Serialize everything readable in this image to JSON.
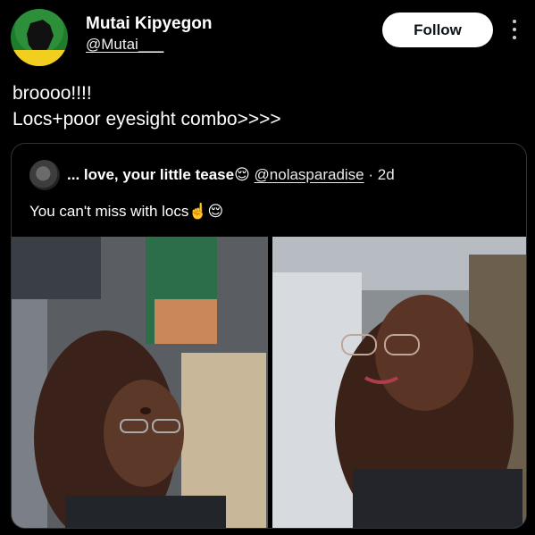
{
  "author": {
    "name": "Mutai Kipyegon",
    "handle": "@Mutai___",
    "avatar_icon": "kenya-map-icon"
  },
  "follow_label": "Follow",
  "more_icon": "more-vertical-icon",
  "post": {
    "text": "broooo!!!!\nLocs+poor eyesight combo>>>>"
  },
  "quoted": {
    "name": "... love, your little tease😌",
    "handle": "@nolasparadise",
    "time": " · 2d",
    "text": "You can't miss with locs☝️😌"
  },
  "colors": {
    "background": "#000000",
    "follow_bg": "#ffffff",
    "border": "#2f3336"
  }
}
